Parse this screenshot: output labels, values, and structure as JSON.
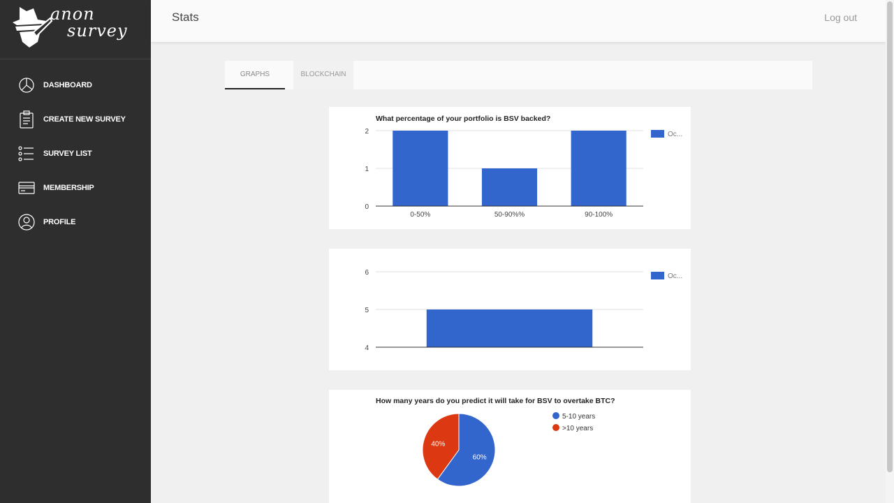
{
  "app": {
    "logo_line1": "anon",
    "logo_line2": "survey"
  },
  "sidebar": {
    "items": [
      {
        "label": "DASHBOARD",
        "icon": "pie-chart-icon"
      },
      {
        "label": "CREATE NEW SURVEY",
        "icon": "clipboard-icon"
      },
      {
        "label": "SURVEY LIST",
        "icon": "list-icon"
      },
      {
        "label": "MEMBERSHIP",
        "icon": "credit-card-icon"
      },
      {
        "label": "PROFILE",
        "icon": "user-icon"
      }
    ]
  },
  "header": {
    "title": "Stats",
    "logout_label": "Log out"
  },
  "tabs": [
    {
      "label": "GRAPHS",
      "active": true
    },
    {
      "label": "BLOCKCHAIN",
      "active": false
    }
  ],
  "colors": {
    "blue": "#3366cc",
    "red": "#dc3912",
    "sidebar": "#2e2e2e"
  },
  "chart_data": [
    {
      "type": "bar",
      "title": "What percentage of your portfolio is BSV backed?",
      "categories": [
        "0-50%",
        "50-90%%",
        "90-100%"
      ],
      "series": [
        {
          "name": "Oc...",
          "values": [
            2,
            1,
            2
          ]
        }
      ],
      "ylim": [
        0,
        2
      ],
      "yticks": [
        "0",
        "1",
        "2"
      ],
      "grid": true,
      "legend": "right"
    },
    {
      "type": "bar",
      "title": "",
      "categories": [
        ""
      ],
      "series": [
        {
          "name": "Oc...",
          "values": [
            5
          ]
        }
      ],
      "ylim": [
        4,
        6
      ],
      "yticks": [
        "4",
        "5",
        "6"
      ],
      "grid": true,
      "legend": "right"
    },
    {
      "type": "pie",
      "title": "How many years do you predict it will take for BSV to overtake BTC?",
      "slices": [
        {
          "label": "5-10 years",
          "value": 60,
          "text": "60%"
        },
        {
          "label": ">10 years",
          "value": 40,
          "text": "40%"
        }
      ],
      "legend": "right"
    }
  ]
}
